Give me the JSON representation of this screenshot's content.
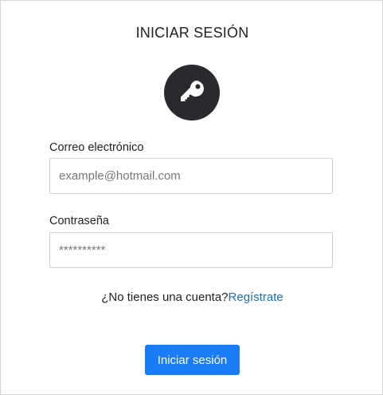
{
  "form": {
    "title": "INICIAR SESIÓN",
    "icon": "key-icon",
    "email_label": "Correo electrónico",
    "email_placeholder": "example@hotmail.com",
    "email_value": "",
    "password_label": "Contraseña",
    "password_placeholder": "**********",
    "password_value": "",
    "signup_prompt": "¿No tienes una cuenta?",
    "signup_link": "Regístrate",
    "submit_label": "Iniciar sesión"
  },
  "colors": {
    "accent": "#1a7cf5",
    "link": "#1a6fb5",
    "icon_circle": "#2a2a2e"
  }
}
